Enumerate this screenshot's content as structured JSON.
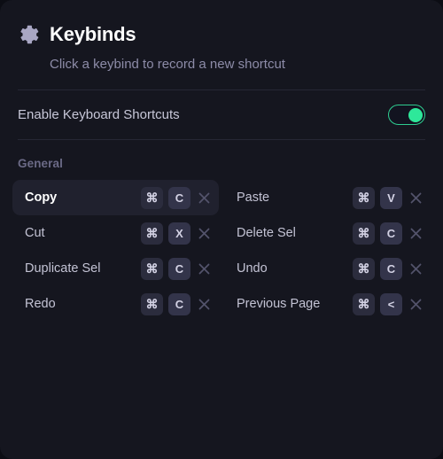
{
  "header": {
    "icon": "gear-icon",
    "title": "Keybinds",
    "subtitle": "Click a keybind to record a new shortcut"
  },
  "settings": {
    "enable_shortcuts": {
      "label": "Enable Keyboard Shortcuts",
      "value": "on",
      "accent_color": "#2ee89a"
    }
  },
  "sections": [
    {
      "title": "General",
      "keybinds": [
        {
          "label": "Copy",
          "keys": [
            "⌘",
            "C"
          ],
          "clear_icon": "close-icon",
          "active": true
        },
        {
          "label": "Paste",
          "keys": [
            "⌘",
            "V"
          ],
          "clear_icon": "close-icon",
          "active": false
        },
        {
          "label": "Cut",
          "keys": [
            "⌘",
            "X"
          ],
          "clear_icon": "close-icon",
          "active": false
        },
        {
          "label": "Delete Sel",
          "keys": [
            "⌘",
            "C"
          ],
          "clear_icon": "close-icon",
          "active": false
        },
        {
          "label": "Duplicate Sel",
          "keys": [
            "⌘",
            "C"
          ],
          "clear_icon": "close-icon",
          "active": false
        },
        {
          "label": "Undo",
          "keys": [
            "⌘",
            "C"
          ],
          "clear_icon": "close-icon",
          "active": false
        },
        {
          "label": "Redo",
          "keys": [
            "⌘",
            "C"
          ],
          "clear_icon": "close-icon",
          "active": false
        },
        {
          "label": "Previous Page",
          "keys": [
            "⌘",
            "<"
          ],
          "clear_icon": "close-icon",
          "active": false
        }
      ]
    }
  ],
  "theme": {
    "card_bg": "#15161f",
    "page_bg": "#0c0d14",
    "divider": "#262735",
    "chip_mod_bg": "#2b2c3d",
    "chip_key_bg": "#33344a",
    "active_row_bg": "#20212e"
  }
}
